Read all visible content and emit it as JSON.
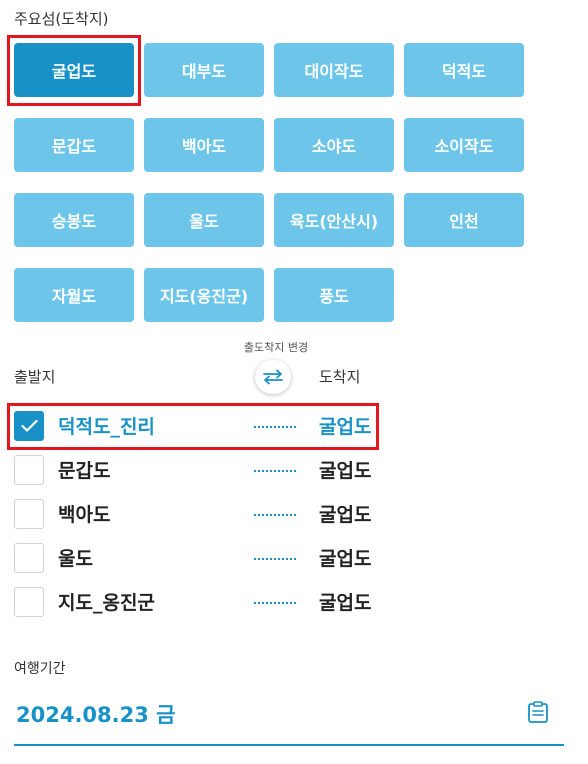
{
  "islands_section": {
    "title": "주요섬(도착지)",
    "items": [
      {
        "label": "굴업도",
        "selected": true
      },
      {
        "label": "대부도",
        "selected": false
      },
      {
        "label": "대이작도",
        "selected": false
      },
      {
        "label": "덕적도",
        "selected": false
      },
      {
        "label": "문갑도",
        "selected": false
      },
      {
        "label": "백아도",
        "selected": false
      },
      {
        "label": "소야도",
        "selected": false
      },
      {
        "label": "소이작도",
        "selected": false
      },
      {
        "label": "승봉도",
        "selected": false
      },
      {
        "label": "울도",
        "selected": false
      },
      {
        "label": "육도(안산시)",
        "selected": false
      },
      {
        "label": "인천",
        "selected": false
      },
      {
        "label": "자월도",
        "selected": false
      },
      {
        "label": "지도(옹진군)",
        "selected": false
      },
      {
        "label": "풍도",
        "selected": false
      }
    ]
  },
  "routes": {
    "swap_label": "출도착지 변경",
    "origin_header": "출발지",
    "destination_header": "도착지",
    "items": [
      {
        "origin": "덕적도_진리",
        "destination": "굴업도",
        "checked": true
      },
      {
        "origin": "문갑도",
        "destination": "굴업도",
        "checked": false
      },
      {
        "origin": "백아도",
        "destination": "굴업도",
        "checked": false
      },
      {
        "origin": "울도",
        "destination": "굴업도",
        "checked": false
      },
      {
        "origin": "지도_옹진군",
        "destination": "굴업도",
        "checked": false
      }
    ]
  },
  "travel_period": {
    "label": "여행기간",
    "date": "2024.08.23 금"
  },
  "colors": {
    "accent": "#1891c6",
    "button": "#6dc6e9",
    "highlight": "#e3171f"
  },
  "icons": {
    "swap": "swap-arrows-icon",
    "check": "check-icon",
    "calendar": "calendar-icon"
  }
}
